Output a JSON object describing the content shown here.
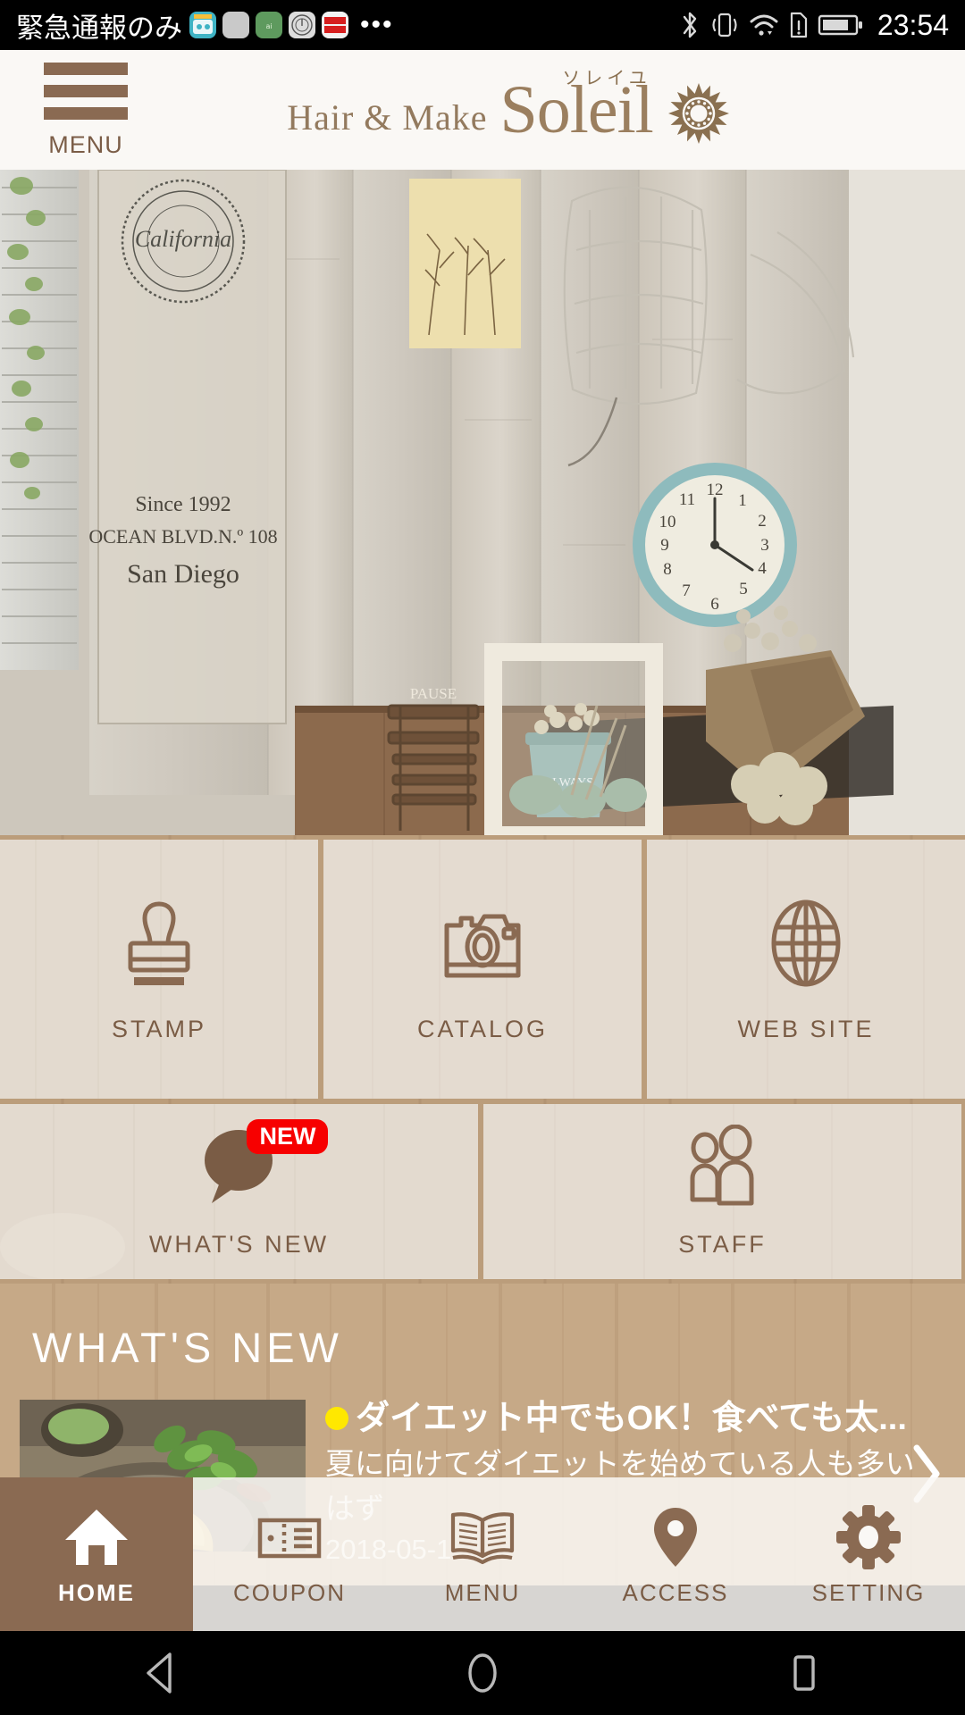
{
  "status_bar": {
    "carrier": "緊急通報のみ",
    "time": "23:54",
    "notification_icons": [
      "app-icon-teal",
      "app-icon-gray",
      "app-icon-green",
      "app-icon-circle-gray",
      "app-icon-red"
    ],
    "overflow": "•••",
    "system_icons": [
      "bluetooth-icon",
      "vibrate-icon",
      "wifi-icon",
      "sim-alert-icon",
      "battery-icon"
    ]
  },
  "header": {
    "menu_label": "MENU",
    "logo_prefix": "Hair & Make",
    "logo_name": "Soleil",
    "logo_furigana": "ソレイユ",
    "brand_color": "#9b7f5f"
  },
  "grid": {
    "row1": [
      {
        "label": "STAMP",
        "icon": "stamp-icon"
      },
      {
        "label": "CATALOG",
        "icon": "camera-icon"
      },
      {
        "label": "WEB SITE",
        "icon": "globe-icon"
      }
    ],
    "row2": [
      {
        "label": "WHAT'S NEW",
        "icon": "speech-bubble-icon",
        "badge": "NEW",
        "badge_color": "#f70000"
      },
      {
        "label": "STAFF",
        "icon": "people-icon"
      }
    ]
  },
  "news": {
    "section_title": "WHAT'S NEW",
    "items": [
      {
        "headline": "ダイエット中でもOK！食べても太...",
        "summary": "夏に向けてダイエットを始めている人も多い",
        "summary2": "はず",
        "date": "2018-05-1",
        "thumbnail": "food-photo"
      }
    ],
    "next_arrow": "chevron-right-icon"
  },
  "tabbar": {
    "items": [
      {
        "label": "HOME",
        "icon": "home-icon",
        "active": true
      },
      {
        "label": "COUPON",
        "icon": "ticket-icon",
        "active": false
      },
      {
        "label": "MENU",
        "icon": "book-icon",
        "active": false
      },
      {
        "label": "ACCESS",
        "icon": "map-pin-icon",
        "active": false
      },
      {
        "label": "SETTING",
        "icon": "gear-icon",
        "active": false
      }
    ],
    "active_color": "#8a6a52"
  },
  "android_nav": {
    "back": "back-triangle-icon",
    "home": "home-circle-icon",
    "recents": "recents-square-icon"
  }
}
